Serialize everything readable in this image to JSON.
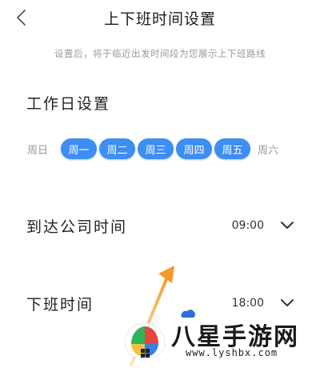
{
  "header": {
    "title": "上下班时间设置",
    "subtitle": "设置后，将于临近出发时间段为您展示上下班路线"
  },
  "workday": {
    "heading": "工作日设置",
    "days": [
      {
        "label": "周日",
        "selected": false
      },
      {
        "label": "周一",
        "selected": true
      },
      {
        "label": "周二",
        "selected": true
      },
      {
        "label": "周三",
        "selected": true
      },
      {
        "label": "周四",
        "selected": true
      },
      {
        "label": "周五",
        "selected": true
      },
      {
        "label": "周六",
        "selected": false
      }
    ]
  },
  "arrive": {
    "label": "到达公司时间",
    "time": "09:00"
  },
  "leave": {
    "label": "下班时间",
    "time": "18:00"
  },
  "watermark": {
    "text": "八星手游网",
    "url": "www.lyshbx.com"
  },
  "colors": {
    "accent": "#3d8df3",
    "muted_text": "#9a9a9a",
    "arrow": "#f39a2a"
  }
}
